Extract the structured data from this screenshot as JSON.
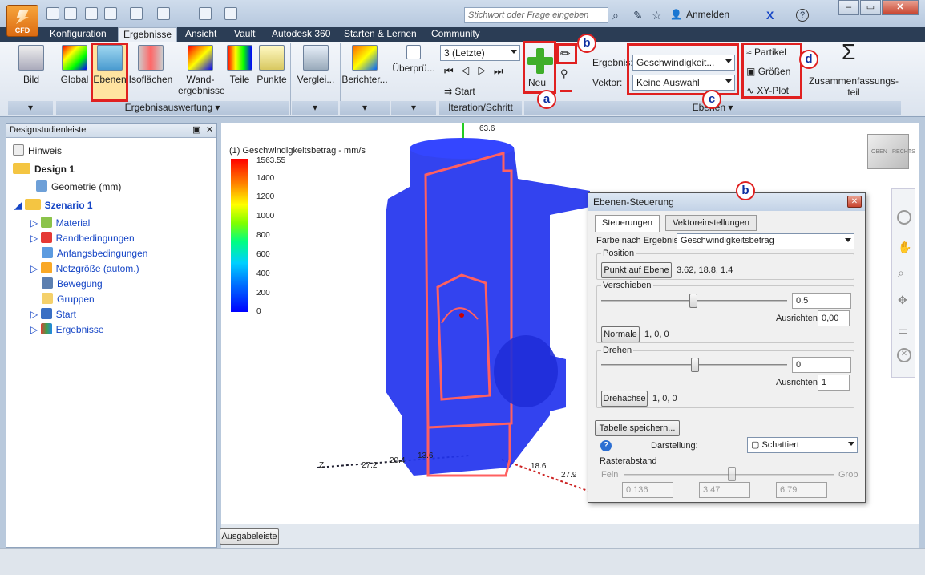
{
  "app": {
    "logo_label": "CFD"
  },
  "titlebar": {
    "search_placeholder": "Stichwort oder Frage eingeben",
    "sign_in": "Anmelden",
    "help": "?"
  },
  "tabs": [
    "Konfiguration",
    "Ergebnisse",
    "Ansicht",
    "Vault",
    "Autodesk 360",
    "Starten & Lernen",
    "Community"
  ],
  "ribbon": {
    "bild": "Bild",
    "global": "Global",
    "ebenen": "Ebenen",
    "isoflaechen": "Isoflächen",
    "wand1": "Wand-",
    "wand2": "ergebnisse",
    "teile": "Teile",
    "punkte": "Punkte",
    "panel_ergebnisauswertung": "Ergebnisauswertung",
    "vergleich": "Verglei...",
    "berichter": "Berichter...",
    "ueberpruef": "Überprü...",
    "iteration_value": "3 (Letzte)",
    "start": "Start",
    "panel_iteration": "Iteration/Schritt",
    "neu": "Neu",
    "ergebnis_label": "Ergebnis:",
    "ergebnis_value": "Geschwindigkeit...",
    "vektor_label": "Vektor:",
    "vektor_value": "Keine Auswahl",
    "partikel": "Partikel",
    "groessen": "Größen",
    "xyplot": "XY-Plot",
    "zusammen1": "Zusammenfassungs-",
    "zusammen2": "teil",
    "panel_ebenen": "Ebenen"
  },
  "annotations": {
    "a": "a",
    "b": "b",
    "c": "c",
    "d": "d",
    "b2": "b"
  },
  "sidebar": {
    "title": "Designstudienleiste",
    "items": [
      "Hinweis",
      "Design 1",
      "Geometrie (mm)",
      "Szenario 1",
      "Material",
      "Randbedingungen",
      "Anfangsbedingungen",
      "Netzgröße (autom.)",
      "Bewegung",
      "Gruppen",
      "Start",
      "Ergebnisse"
    ]
  },
  "viewport": {
    "legend_title": "(1) Geschwindigkeitsbetrag - mm/s",
    "legend_values": [
      "1563.55",
      "1400",
      "1200",
      "1000",
      "800",
      "600",
      "400",
      "200",
      "0"
    ],
    "axis_labels": [
      "63.6",
      "27.2",
      "20.4",
      "13.6",
      "18.6",
      "27.9",
      "Z"
    ],
    "viewcube_front": "OBEN",
    "viewcube_right": "RECHTS",
    "output_button": "Ausgabeleiste"
  },
  "dialog": {
    "title": "Ebenen-Steuerung",
    "tabs": [
      "Steuerungen",
      "Vektoreinstellungen"
    ],
    "farbe_label": "Farbe nach Ergebnis",
    "farbe_value": "Geschwindigkeitsbetrag",
    "position_group": "Position",
    "punkt_button": "Punkt auf Ebene",
    "punkt_value": "3.62, 18.8, 1.4",
    "verschieben_group": "Verschieben",
    "verschieben_value": "0.5",
    "ausrichten_label": "Ausrichten",
    "ausrichten_value1": "0,00",
    "normale_button": "Normale",
    "normale_value": "1, 0, 0",
    "drehen_group": "Drehen",
    "drehen_value": "0",
    "ausrichten_value2": "1",
    "drehachse_button": "Drehachse",
    "drehachse_value": "1, 0, 0",
    "tabelle_button": "Tabelle speichern...",
    "darstellung_label": "Darstellung:",
    "darstellung_value": "Schattiert",
    "raster_label": "Rasterabstand",
    "fein": "Fein",
    "grob": "Grob",
    "raster_values": [
      "0.136",
      "3.47",
      "6.79"
    ]
  }
}
